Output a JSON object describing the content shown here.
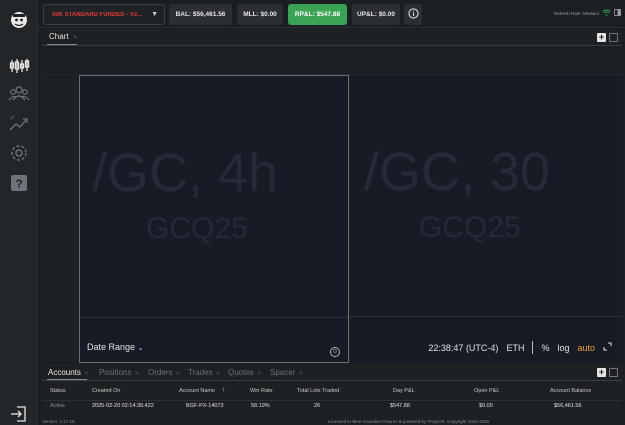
{
  "topbar": {
    "account": "50K STANDARD FUNDED - V2...",
    "balance": "BAL: $56,461.56",
    "mll": "MLL: $0.00",
    "rpnl": "RP&L: $547.88",
    "upnl": "UP&L: $0.00",
    "refresh": "Refresh Rate: Medium"
  },
  "chart": {
    "tab_label": "Chart",
    "left_pane": {
      "symbol": "/GC, 4h",
      "contract": "GCQ25"
    },
    "right_pane": {
      "symbol": "/GC, 30",
      "contract": "GCQ25"
    },
    "date_range": "Date Range",
    "time": "22:38:47 (UTC-4)",
    "session": "ETH",
    "percent": "%",
    "log": "log",
    "auto": "auto"
  },
  "bottom": {
    "tabs": [
      {
        "label": "Accounts",
        "active": true
      },
      {
        "label": "Positions",
        "active": false
      },
      {
        "label": "Orders",
        "active": false
      },
      {
        "label": "Trades",
        "active": false
      },
      {
        "label": "Quotes",
        "active": false
      },
      {
        "label": "Spacer",
        "active": false
      }
    ],
    "columns": [
      "Status",
      "Created On",
      "Account Name",
      "Win Rate",
      "Total Lots Traded",
      "Day P&L",
      "Open P&L",
      "Account Balance"
    ],
    "rows": [
      [
        "Active",
        "2025-02-20 02:14:38.422",
        "BGF-PX-14073",
        "58.19%",
        "26",
        "$547.88",
        "$0.00",
        "$56,461.56"
      ]
    ]
  },
  "footer": {
    "version": "Version: 1.17.15",
    "license": "Licensed to Blue Guardian Futures & powered by ProjectX. Copyright 2024-2025"
  },
  "colors": {
    "accent_green": "#3aa454",
    "account_red": "#e03a3a",
    "auto_orange": "#f0a020"
  }
}
